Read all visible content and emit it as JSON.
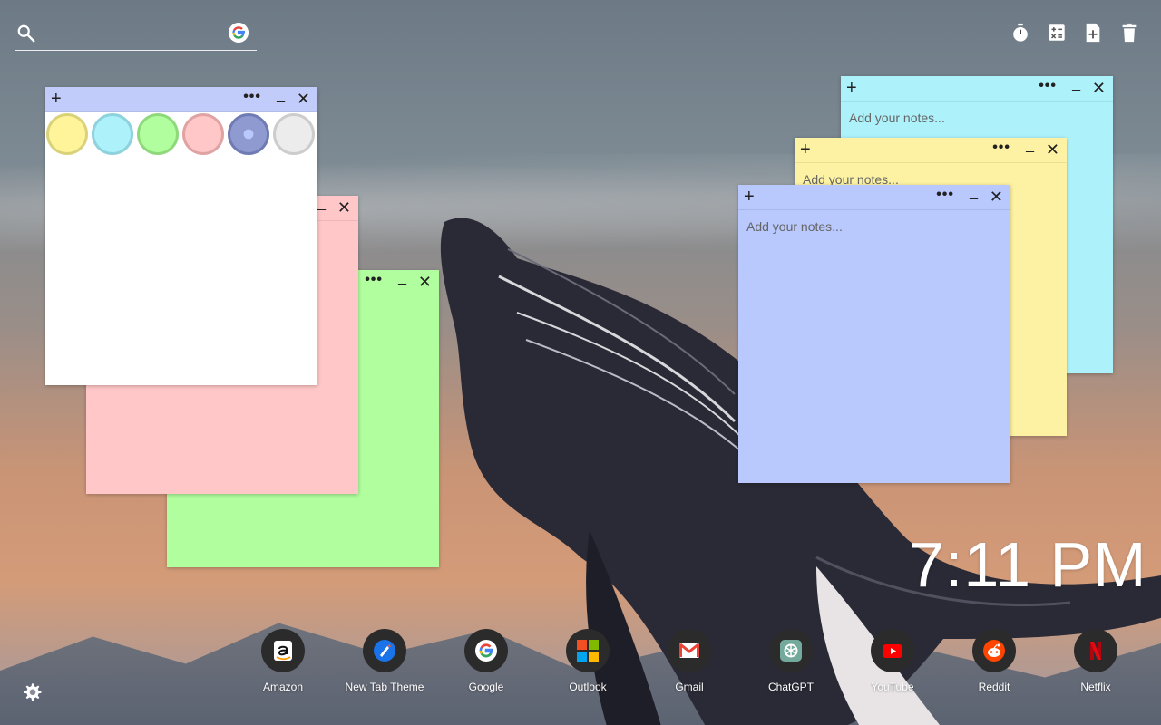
{
  "search": {
    "placeholder": "",
    "value": ""
  },
  "toolbar": {
    "timer": "timer-icon",
    "calculator": "calculator-icon",
    "new_note": "add-note-icon",
    "trash": "trash-icon"
  },
  "notes": {
    "white": {
      "color": "#ffffff",
      "head_color": "#c2ccfa"
    },
    "pink": {
      "color": "#ffc7c7"
    },
    "green": {
      "color": "#b1fe9e"
    },
    "cyan": {
      "color": "#adf2fb",
      "placeholder": "Add your notes..."
    },
    "yellow": {
      "color": "#fdf2a3",
      "placeholder": "Add your notes..."
    },
    "blue": {
      "color": "#b9c8fd",
      "placeholder": "Add your notes..."
    }
  },
  "palette": [
    {
      "name": "yellow",
      "fill": "#fff49a",
      "ring": "#d9d27a"
    },
    {
      "name": "cyan",
      "fill": "#adf2fb",
      "ring": "#8dd2dc"
    },
    {
      "name": "green",
      "fill": "#b1fe9e",
      "ring": "#8fd97c"
    },
    {
      "name": "pink",
      "fill": "#ffc7c7",
      "ring": "#e0a3a3"
    },
    {
      "name": "blue",
      "fill": "#8f9bd0",
      "ring": "#6f7bb3",
      "selected": true
    },
    {
      "name": "gray",
      "fill": "#ececec",
      "ring": "#cccccc"
    }
  ],
  "note_controls": {
    "add": "+",
    "more": "•••",
    "minimize": "_",
    "close": "✕"
  },
  "clock": {
    "time": "7:11 PM"
  },
  "shortcuts": [
    {
      "label": "Amazon",
      "icon": "amazon-icon"
    },
    {
      "label": "New Tab Theme",
      "icon": "new-tab-theme-icon"
    },
    {
      "label": "Google",
      "icon": "google-icon"
    },
    {
      "label": "Outlook",
      "icon": "outlook-icon"
    },
    {
      "label": "Gmail",
      "icon": "gmail-icon"
    },
    {
      "label": "ChatGPT",
      "icon": "chatgpt-icon"
    },
    {
      "label": "YouTube",
      "icon": "youtube-icon"
    },
    {
      "label": "Reddit",
      "icon": "reddit-icon"
    },
    {
      "label": "Netflix",
      "icon": "netflix-icon"
    }
  ]
}
